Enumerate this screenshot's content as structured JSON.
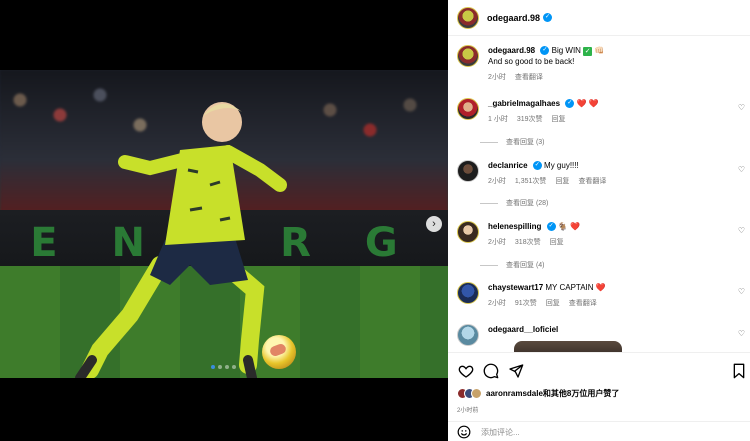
{
  "post": {
    "author": "odegaard.98",
    "caption_user": "odegaard.98",
    "caption_line1": "Big WIN",
    "caption_line2": "And so good to be back!",
    "caption_time": "2小时",
    "caption_translate": "查看翻译",
    "board_text": "E N E R G Y",
    "carousel_count": 4,
    "carousel_index": 0
  },
  "comments": [
    {
      "user": "_gabrielmagalhaes",
      "text": "❤️ ❤️",
      "time": "1 小时",
      "likes": "319次赞",
      "reply": "回复",
      "view_replies": "查看回复 (3)"
    },
    {
      "user": "declanrice",
      "text": "My guy!!!!",
      "time": "2小时",
      "likes": "1,351次赞",
      "reply": "回复",
      "translate": "查看翻译",
      "view_replies": "查看回复 (28)"
    },
    {
      "user": "helenespilling",
      "text": "🐐 ❤️",
      "time": "2小时",
      "likes": "318次赞",
      "reply": "回复",
      "view_replies": "查看回复 (4)"
    },
    {
      "user": "chaystewart17",
      "text": "MY CAPTAIN ❤️",
      "time": "2小时",
      "likes": "91次赞",
      "reply": "回复",
      "translate": "查看翻译"
    },
    {
      "user": "odegaard__loficiel",
      "text": ""
    }
  ],
  "likes_bar": {
    "user": "aaronramsdale",
    "rest": "和其他8万位用户赞了",
    "time": "2小时前"
  },
  "add_comment_placeholder": "添加评论...",
  "colors": {
    "accent": "#0095f6",
    "heart": "#ed2d43",
    "kit": "#c8e02a"
  }
}
